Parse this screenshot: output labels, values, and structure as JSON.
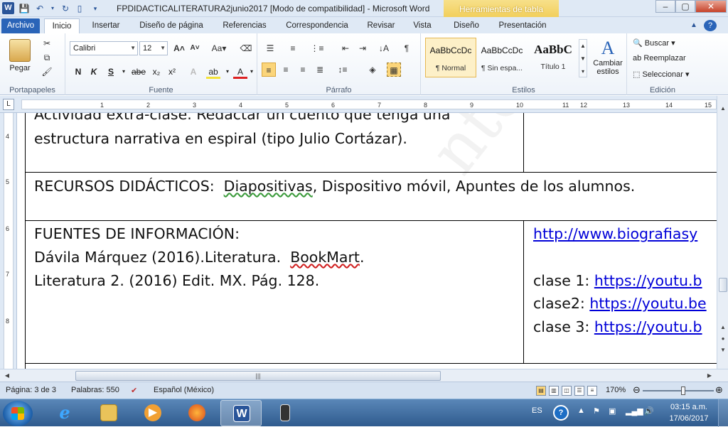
{
  "window": {
    "app_letter": "W",
    "title": "FPDIDACTICALITERATURA2junio2017 [Modo de compatibilidad] - Microsoft Word",
    "context_header": "Herramientas de tabla",
    "minimize": "–",
    "maximize": "▢",
    "close": "✕"
  },
  "tabs": [
    {
      "label": "Archivo"
    },
    {
      "label": "Inicio"
    },
    {
      "label": "Insertar"
    },
    {
      "label": "Diseño de página"
    },
    {
      "label": "Referencias"
    },
    {
      "label": "Correspondencia"
    },
    {
      "label": "Revisar"
    },
    {
      "label": "Vista"
    },
    {
      "label": "Diseño"
    },
    {
      "label": "Presentación"
    }
  ],
  "ribbon": {
    "clipboard": {
      "paste_label": "Pegar",
      "group_label": "Portapapeles"
    },
    "font": {
      "font_name": "Calibri",
      "font_size": "12",
      "group_label": "Fuente",
      "bold": "N",
      "italic": "K",
      "underline": "S",
      "strike": "abe",
      "sub": "x₂",
      "sup": "x²"
    },
    "paragraph": {
      "group_label": "Párrafo"
    },
    "styles": {
      "group_label": "Estilos",
      "items": [
        {
          "sample": "AaBbCcDc",
          "name": "¶ Normal"
        },
        {
          "sample": "AaBbCcDc",
          "name": "¶ Sin espa..."
        },
        {
          "sample": "AaBbC",
          "name": "Título 1"
        }
      ],
      "change_styles": "Cambiar estilos"
    },
    "editing": {
      "group_label": "Edición",
      "find": "Buscar",
      "replace": "Reemplazar",
      "select": "Seleccionar"
    }
  },
  "document": {
    "row1_line1": "Actividad extra-clase. Redactar un cuento que tenga una",
    "row1_line2": "estructura narrativa en espiral (tipo Julio Cortázar).",
    "row2_label": "RECURSOS DIDÁCTICOS:",
    "row2_item1": "Diapositivas",
    "row2_rest": ", Dispositivo móvil, Apuntes de los alumnos.",
    "row3_heading": "FUENTES DE INFORMACIÓN:",
    "row3_line2a": "Dávila Márquez (2016).Literatura.",
    "row3_line2b": "BookMart",
    "row3_line2c": ".",
    "row3_line3": "Literatura  2. (2016) Edit. MX. Pág. 128.",
    "right_link": "http://www.biografiasy",
    "clase1_label": "clase 1:",
    "clase1_link": "https://youtu.b",
    "clase2_label": "clase2:",
    "clase2_link": "https://youtu.be",
    "clase3_label": "clase 3:",
    "clase3_link": "https://youtu.b",
    "watermark": "nto de Tra"
  },
  "statusbar": {
    "page": "Página: 3 de 3",
    "words": "Palabras: 550",
    "language": "Español (México)",
    "zoom": "170%"
  },
  "taskbar": {
    "lang": "ES",
    "time": "03:15 a.m.",
    "date": "17/06/2017"
  },
  "ruler_numbers": [
    "1",
    "2",
    "3",
    "4",
    "5",
    "6",
    "7",
    "8",
    "9",
    "10",
    "11",
    "12",
    "13",
    "14",
    "15"
  ],
  "vruler_numbers": [
    "4",
    "5",
    "6",
    "7",
    "8"
  ]
}
